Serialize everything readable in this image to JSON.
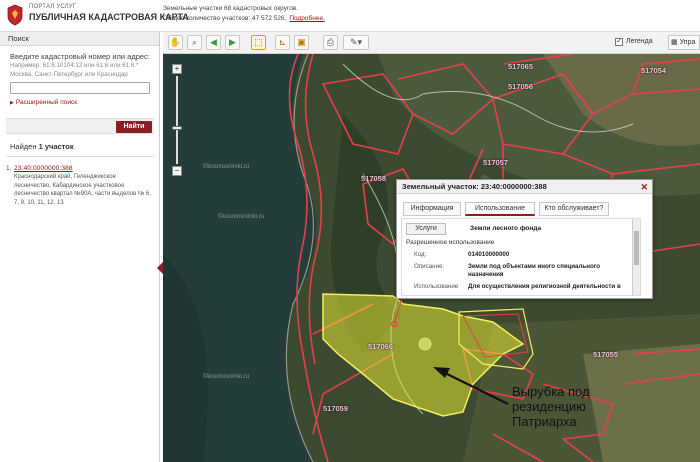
{
  "header": {
    "portal_label": "ПОРТАЛ УСЛУГ",
    "portal_title": "ПУБЛИЧНАЯ КАДАСТРОВАЯ КАРТА",
    "info_line1": "Земельные участки 68 кадастровых округов.",
    "info_line2": "Общее количество участков: 47 572 526.",
    "more_link": "Подробнее."
  },
  "search_panel": {
    "title": "Поиск",
    "prompt": "Введите кадастровый номер или адрес:",
    "hint1": "Например: 61:6:10104:12 или 61:6 или 61:6:*",
    "hint2": "Москва, Санкт-Петербург или Краснодар",
    "input_value": "",
    "advanced_label": "Расширенный поиск",
    "find_button": "Найти",
    "found_prefix": "Найден",
    "found_count": "1 участок",
    "results": [
      {
        "num": "1.",
        "cadastral": "23:40:0000000:388",
        "description": "Краснодарский край, Геленджикское лесничество, Кабардинское участковое лесничество квартал №90А, части выделов № 6, 7, 9, 10, 11, 12, 13"
      }
    ]
  },
  "map_toolbar": {
    "legend_label": "Легенда",
    "legend_checked": "✓",
    "manage_label": "Упра"
  },
  "map": {
    "parcel_labels": [
      "517065",
      "517056",
      "517054",
      "517057",
      "517058",
      "517059",
      "517066",
      "517055"
    ],
    "watermarks": [
      "©kosmosnimki.ru",
      "©kosmosnimki.ru",
      "©kosmosnimki.ru"
    ],
    "highlight_color": "#e6e633",
    "boundary_color": "#e8404a"
  },
  "popup": {
    "title": "Земельный участок: 23:40:0000000:388",
    "tabs": [
      "Информация",
      "Использование",
      "Кто обслуживает?"
    ],
    "active_tab": "Использование",
    "services_button": "Услуги",
    "category_value": "Земли лесного фонда",
    "section_title": "Разрешенное использование",
    "rows": [
      {
        "label": "Код:",
        "value": "014010000000"
      },
      {
        "label": "Описание:",
        "value": "Земли под объектами иного специального назначения"
      },
      {
        "label": "Использование",
        "value": "Для осуществления религиозной деятельности в"
      }
    ]
  },
  "annotation": "Вырубка под резиденцию Патриарха"
}
